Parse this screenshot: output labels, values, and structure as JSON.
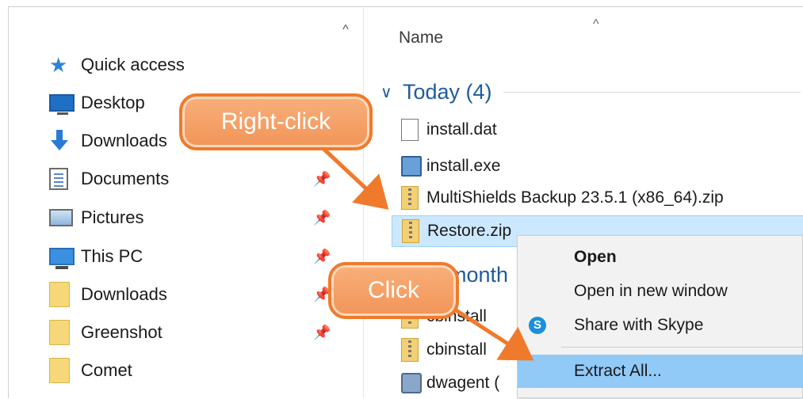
{
  "nav": {
    "items": [
      {
        "label": "Quick access",
        "icon": "star-icon",
        "pinned": false
      },
      {
        "label": "Desktop",
        "icon": "desktop-icon",
        "pinned": false
      },
      {
        "label": "Downloads",
        "icon": "download-arrow-icon",
        "pinned": false
      },
      {
        "label": "Documents",
        "icon": "documents-icon",
        "pinned": true
      },
      {
        "label": "Pictures",
        "icon": "pictures-icon",
        "pinned": true
      },
      {
        "label": "This PC",
        "icon": "computer-icon",
        "pinned": true
      },
      {
        "label": "Downloads",
        "icon": "folder-icon",
        "pinned": true
      },
      {
        "label": "Greenshot",
        "icon": "folder-icon",
        "pinned": true
      },
      {
        "label": "Comet",
        "icon": "folder-icon",
        "pinned": false
      }
    ],
    "scroll_up_glyph": "^",
    "pin_glyph": "📌"
  },
  "list": {
    "column_header": "Name",
    "sort_glyph": "^",
    "group1_label": "Today (4)",
    "group1_chevron": "∨",
    "group2_partial": "month",
    "files": [
      {
        "name": "install.dat",
        "icon": "dat-file-icon"
      },
      {
        "name": "install.exe",
        "icon": "exe-file-icon"
      },
      {
        "name": "MultiShields Backup 23.5.1 (x86_64).zip",
        "icon": "zip-file-icon"
      },
      {
        "name": "Restore.zip",
        "icon": "zip-file-icon",
        "selected": true
      },
      {
        "name": "cbinstall",
        "icon": "zip-file-icon"
      },
      {
        "name": "cbinstall",
        "icon": "zip-file-icon"
      },
      {
        "name": "dwagent (",
        "icon": "app-file-icon"
      }
    ]
  },
  "context_menu": {
    "items": [
      {
        "label": "Open",
        "bold": true
      },
      {
        "label": "Open in new window"
      },
      {
        "label": "Share with Skype",
        "icon": "skype-icon"
      },
      {
        "label": "Extract All...",
        "highlighted": true
      }
    ],
    "skype_glyph": "S"
  },
  "annotations": {
    "right_click": "Right-click",
    "click": "Click"
  },
  "colors": {
    "callout_fill": "#f29458",
    "callout_border": "#f07a2c",
    "selection": "#cce8ff",
    "menu_highlight": "#91c9f7",
    "group_label": "#1e5b9c"
  }
}
